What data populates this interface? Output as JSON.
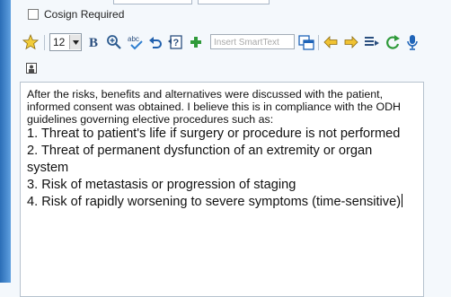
{
  "cosign": {
    "label": "Cosign Required",
    "checked": false
  },
  "toolbar": {
    "font_size": "12",
    "smarttext_placeholder": "Insert SmartText"
  },
  "note": {
    "intro": "After the risks, benefits and alternatives were discussed with the patient, informed consent was obtained.  I believe this is in compliance with the ODH guidelines governing elective procedures such as:",
    "items": [
      "1. Threat to patient's life if surgery or procedure is not performed",
      "2. Threat of permanent dysfunction of an extremity or organ system",
      "3. Risk of metastasis or progression of staging",
      "4. Risk of rapidly worsening to severe symptoms (time-sensitive)"
    ]
  },
  "colors": {
    "accent_blue": "#1f64b8",
    "green": "#2f9a3a",
    "gold": "#e2b11f",
    "window_bg": "#f4f8fc"
  }
}
